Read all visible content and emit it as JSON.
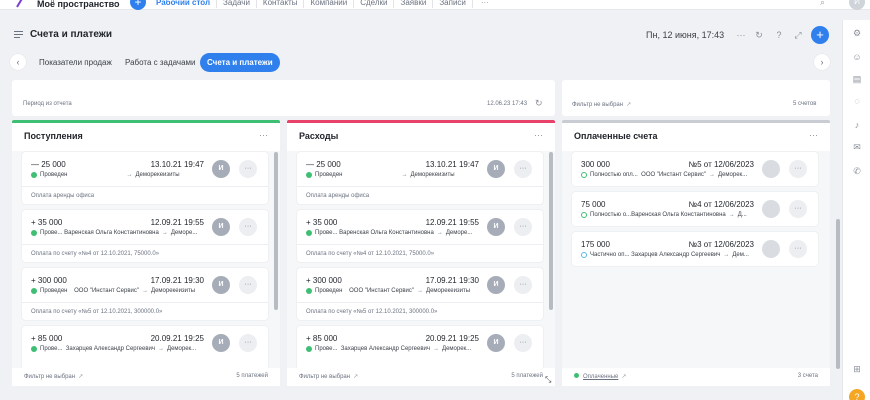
{
  "topnav": {
    "workspace": "Моё пространство",
    "tabs": [
      "Рабочий стол",
      "Задачи",
      "Контакты",
      "Компании",
      "Сделки",
      "Заявки",
      "Записи"
    ],
    "more": "···",
    "avatar": "И",
    "accent": "#2f80ed"
  },
  "header": {
    "title": "Счета и платежи",
    "datetime": "Пн, 12 июня, 17:43",
    "more": "···"
  },
  "subtabs": {
    "items": [
      "Показатели продаж",
      "Работа с задачами",
      "Счета и платежи"
    ],
    "active_index": 2
  },
  "filters": {
    "left_period": "Период из отчета",
    "left_datetime": "12.06.23 17:43",
    "right_filter": "Фильтр не выбран",
    "right_count": "5 счетов"
  },
  "columns": {
    "incoming": {
      "title": "Поступления",
      "color": "#3fbf73",
      "footer_filter": "Фильтр не выбран",
      "footer_count": "5 платежей",
      "cards": [
        {
          "amount": "— 25 000",
          "date": "13.10.21 19:47",
          "status": "Проведен",
          "from": "",
          "to": "Деморекеизиты",
          "note": "Оплата аренды офиса",
          "avatar": "И"
        },
        {
          "amount": "+ 35 000",
          "date": "12.09.21 19:55",
          "status": "Прове...",
          "from": "Варенская Ольга Константиновна",
          "to": "Деморе...",
          "note": "Оплата по счету «№4 от 12.10.2021, 75000.0»",
          "avatar": "И"
        },
        {
          "amount": "+ 300 000",
          "date": "17.09.21 19:30",
          "status": "Проведен",
          "from": "ООО \"Инстант Сервис\"",
          "to": "Деморекеизиты",
          "note": "Оплата по счету «№5 от 12.10.2021, 300000.0»",
          "avatar": "И"
        },
        {
          "amount": "+ 85 000",
          "date": "20.09.21 19:25",
          "status": "Прове...",
          "from": "Захарцев Александр Сергеевич",
          "to": "Деморек...",
          "note": "",
          "avatar": "И"
        }
      ]
    },
    "expenses": {
      "title": "Расходы",
      "color": "#e8416a",
      "footer_filter": "Фильтр не выбран",
      "footer_count": "5 платежей",
      "cards": [
        {
          "amount": "— 25 000",
          "date": "13.10.21 19:47",
          "status": "Проведен",
          "from": "",
          "to": "Деморекеизиты",
          "note": "Оплата аренды офиса",
          "avatar": "И"
        },
        {
          "amount": "+ 35 000",
          "date": "12.09.21 19:55",
          "status": "Прове...",
          "from": "Варенская Ольга Константиновна",
          "to": "Деморе...",
          "note": "Оплата по счету «№4 от 12.10.2021, 75000.0»",
          "avatar": "И"
        },
        {
          "amount": "+ 300 000",
          "date": "17.09.21 19:30",
          "status": "Проведен",
          "from": "ООО \"Инстант Сервис\"",
          "to": "Деморекеизиты",
          "note": "Оплата по счету «№5 от 12.10.2021, 300000.0»",
          "avatar": "И"
        },
        {
          "amount": "+ 85 000",
          "date": "20.09.21 19:25",
          "status": "Прове...",
          "from": "Захарцев Александр Сергеевич",
          "to": "Деморек...",
          "note": "",
          "avatar": "И"
        }
      ]
    },
    "paid": {
      "title": "Оплаченные счета",
      "color": "#c9ccd2",
      "footer_filter": "Оплаченные",
      "footer_count": "3 счета",
      "cards": [
        {
          "amount": "300 000",
          "number": "№5 от 12/06/2023",
          "status": "Полностью опл...",
          "from": "ООО \"Инстант Сервис\"",
          "to": "Деморек..."
        },
        {
          "amount": "75 000",
          "number": "№4 от 12/06/2023",
          "status": "Полностью о...",
          "from": "Варенская Ольга Константиновна",
          "to": "Д..."
        },
        {
          "amount": "175 000",
          "number": "№3 от 12/06/2023",
          "status": "Частично оп...",
          "from": "Захарцев Александр Сергеевич",
          "to": "Дем..."
        }
      ]
    }
  }
}
